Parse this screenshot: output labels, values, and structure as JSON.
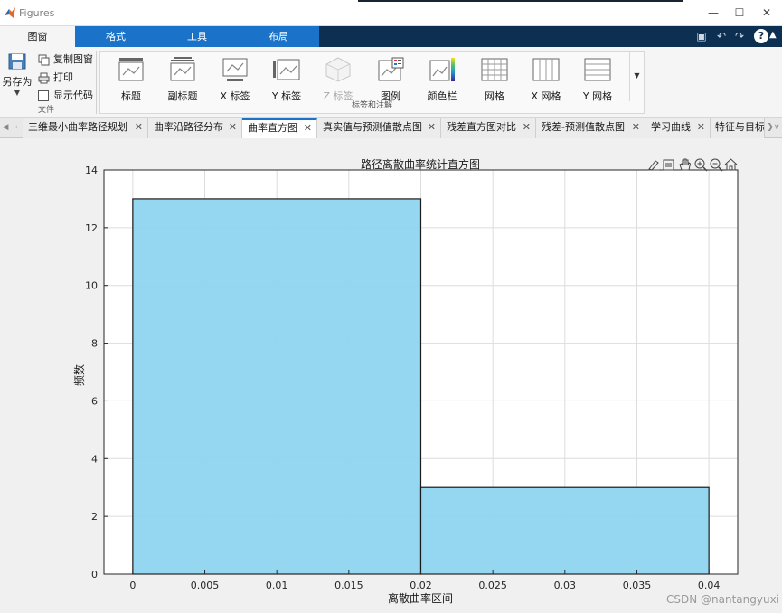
{
  "window": {
    "title": "Figures"
  },
  "ribbon_tabs": [
    {
      "label": "图窗",
      "active": true
    },
    {
      "label": "格式",
      "active": false
    },
    {
      "label": "工具",
      "active": false
    },
    {
      "label": "布局",
      "active": false
    }
  ],
  "file_group": {
    "save_as": "另存为",
    "copy_figure": "复制图窗",
    "print": "打印",
    "show_code": "显示代码",
    "group_label": "文件"
  },
  "labels_group": {
    "group_label": "标签和注解",
    "buttons": [
      {
        "label": "标题",
        "icon": "title-icon",
        "enabled": true
      },
      {
        "label": "副标题",
        "icon": "subtitle-icon",
        "enabled": true
      },
      {
        "label": "X 标签",
        "icon": "x-label-icon",
        "enabled": true
      },
      {
        "label": "Y 标签",
        "icon": "y-label-icon",
        "enabled": true
      },
      {
        "label": "Z 标签",
        "icon": "z-label-icon",
        "enabled": false
      },
      {
        "label": "图例",
        "icon": "legend-icon",
        "enabled": true
      },
      {
        "label": "颜色栏",
        "icon": "colorbar-icon",
        "enabled": true
      },
      {
        "label": "网格",
        "icon": "grid-icon",
        "enabled": true
      },
      {
        "label": "X 网格",
        "icon": "x-grid-icon",
        "enabled": true
      },
      {
        "label": "Y 网格",
        "icon": "y-grid-icon",
        "enabled": true
      }
    ]
  },
  "doc_tabs": [
    {
      "label": "三维最小曲率路径规划",
      "active": false
    },
    {
      "label": "曲率沿路径分布",
      "active": false
    },
    {
      "label": "曲率直方图",
      "active": true
    },
    {
      "label": "真实值与预测值散点图",
      "active": false
    },
    {
      "label": "残差直方图对比",
      "active": false
    },
    {
      "label": "残差-预测值散点图",
      "active": false
    },
    {
      "label": "学习曲线",
      "active": false
    },
    {
      "label": "特征与目标",
      "active": false
    }
  ],
  "axes_toolbar": [
    "brush-icon",
    "datatip-icon",
    "pan-icon",
    "zoom-in-icon",
    "zoom-out-icon",
    "home-icon"
  ],
  "watermark": "CSDN @nantangyuxi",
  "colors": {
    "bar_fill": "#8fd4f0",
    "bar_edge": "#1a1a1a",
    "accent_tab": "#1a73c8",
    "titlebar_dark": "#0d2f52"
  },
  "chart_data": {
    "type": "bar",
    "subtype": "histogram",
    "title": "路径离散曲率统计直方图",
    "xlabel": "离散曲率区间",
    "ylabel": "频数",
    "bin_edges": [
      0,
      0.02,
      0.04
    ],
    "values": [
      13,
      3
    ],
    "xlim": [
      -0.002,
      0.042
    ],
    "ylim": [
      0,
      14
    ],
    "xticks": [
      0,
      0.005,
      0.01,
      0.015,
      0.02,
      0.025,
      0.03,
      0.035,
      0.04
    ],
    "xtick_labels": [
      "0",
      "0.005",
      "0.01",
      "0.015",
      "0.02",
      "0.025",
      "0.03",
      "0.035",
      "0.04"
    ],
    "yticks": [
      0,
      2,
      4,
      6,
      8,
      10,
      12,
      14
    ],
    "ytick_labels": [
      "0",
      "2",
      "4",
      "6",
      "8",
      "10",
      "12",
      "14"
    ],
    "grid": true,
    "legend": "none"
  }
}
